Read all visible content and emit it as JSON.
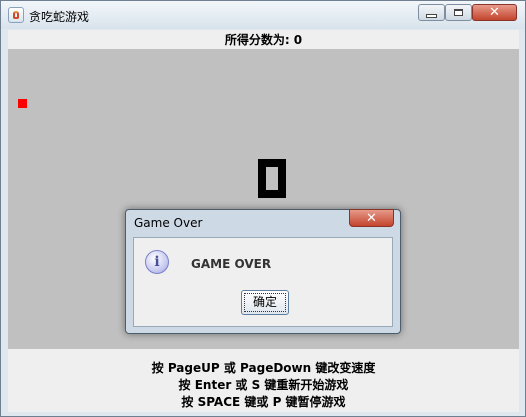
{
  "window": {
    "title": "贪吃蛇游戏"
  },
  "game": {
    "score_text": "所得分数为: 0",
    "colors": {
      "board": "#c0c0c0",
      "food": "#ff0000",
      "snake": "#000000"
    }
  },
  "hints": [
    "按 PageUP 或 PageDown 键改变速度",
    "按 Enter 或 S 键重新开始游戏",
    "按 SPACE 键或 P 键暂停游戏"
  ],
  "dialog": {
    "title": "Game Over",
    "message": "GAME OVER",
    "icon": "info-icon",
    "ok_label": "确定"
  }
}
